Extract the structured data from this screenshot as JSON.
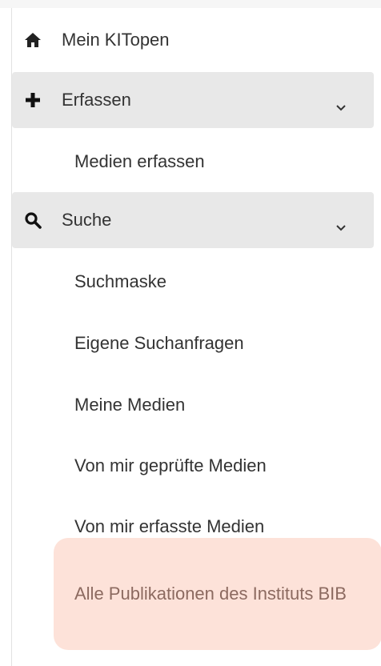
{
  "nav": {
    "home": {
      "label": "Mein KITopen",
      "icon": "home-icon"
    },
    "erfassen": {
      "label": "Erfassen",
      "icon": "plus-icon",
      "expanded": true,
      "items": [
        {
          "label": "Medien erfassen"
        }
      ]
    },
    "suche": {
      "label": "Suche",
      "icon": "search-icon",
      "expanded": true,
      "items": [
        {
          "label": "Suchmaske"
        },
        {
          "label": "Eigene Suchanfragen"
        },
        {
          "label": "Meine Medien"
        },
        {
          "label": "Von mir geprüfte Medien"
        },
        {
          "label": "Von mir erfasste Medien"
        },
        {
          "label": "Alle Publikationen des Instituts BIB",
          "active": true
        }
      ]
    }
  },
  "colors": {
    "group_background": "#e8e8e8",
    "active_background": "#fde2d9",
    "active_text": "#8c6a60",
    "text": "#333333"
  }
}
